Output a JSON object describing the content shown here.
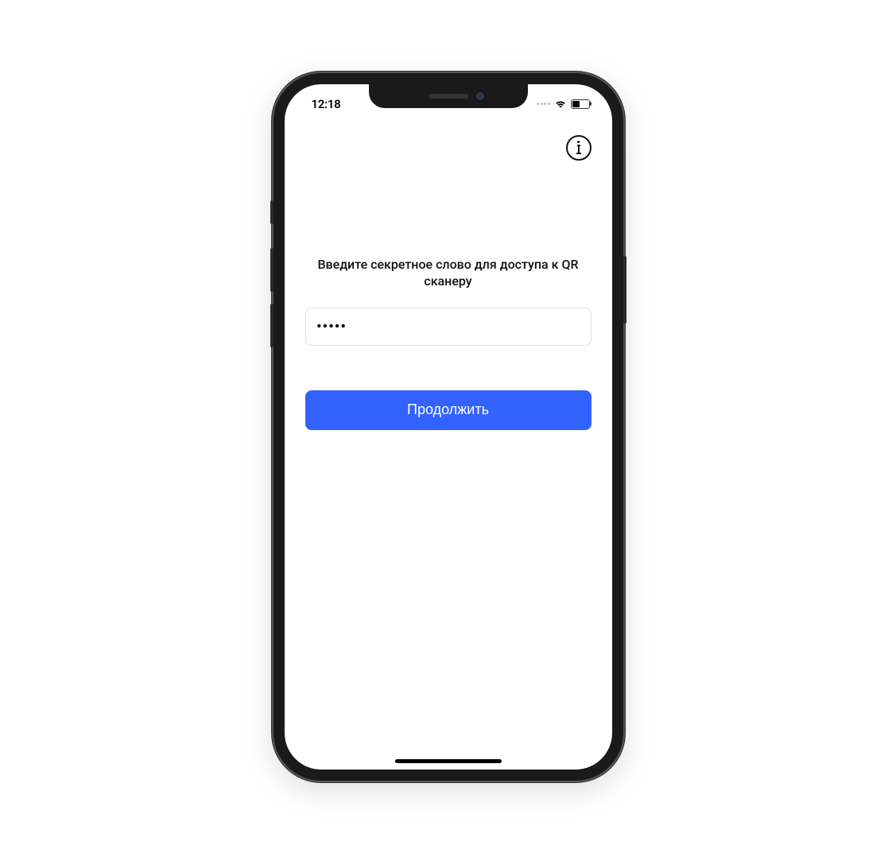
{
  "status_bar": {
    "time": "12:18"
  },
  "header": {
    "info_icon": "info-icon"
  },
  "main": {
    "prompt_text": "Введите секретное слово для доступа к QR сканеру",
    "secret_value": "•••••",
    "continue_label": "Продолжить"
  },
  "colors": {
    "primary": "#3262ff"
  }
}
